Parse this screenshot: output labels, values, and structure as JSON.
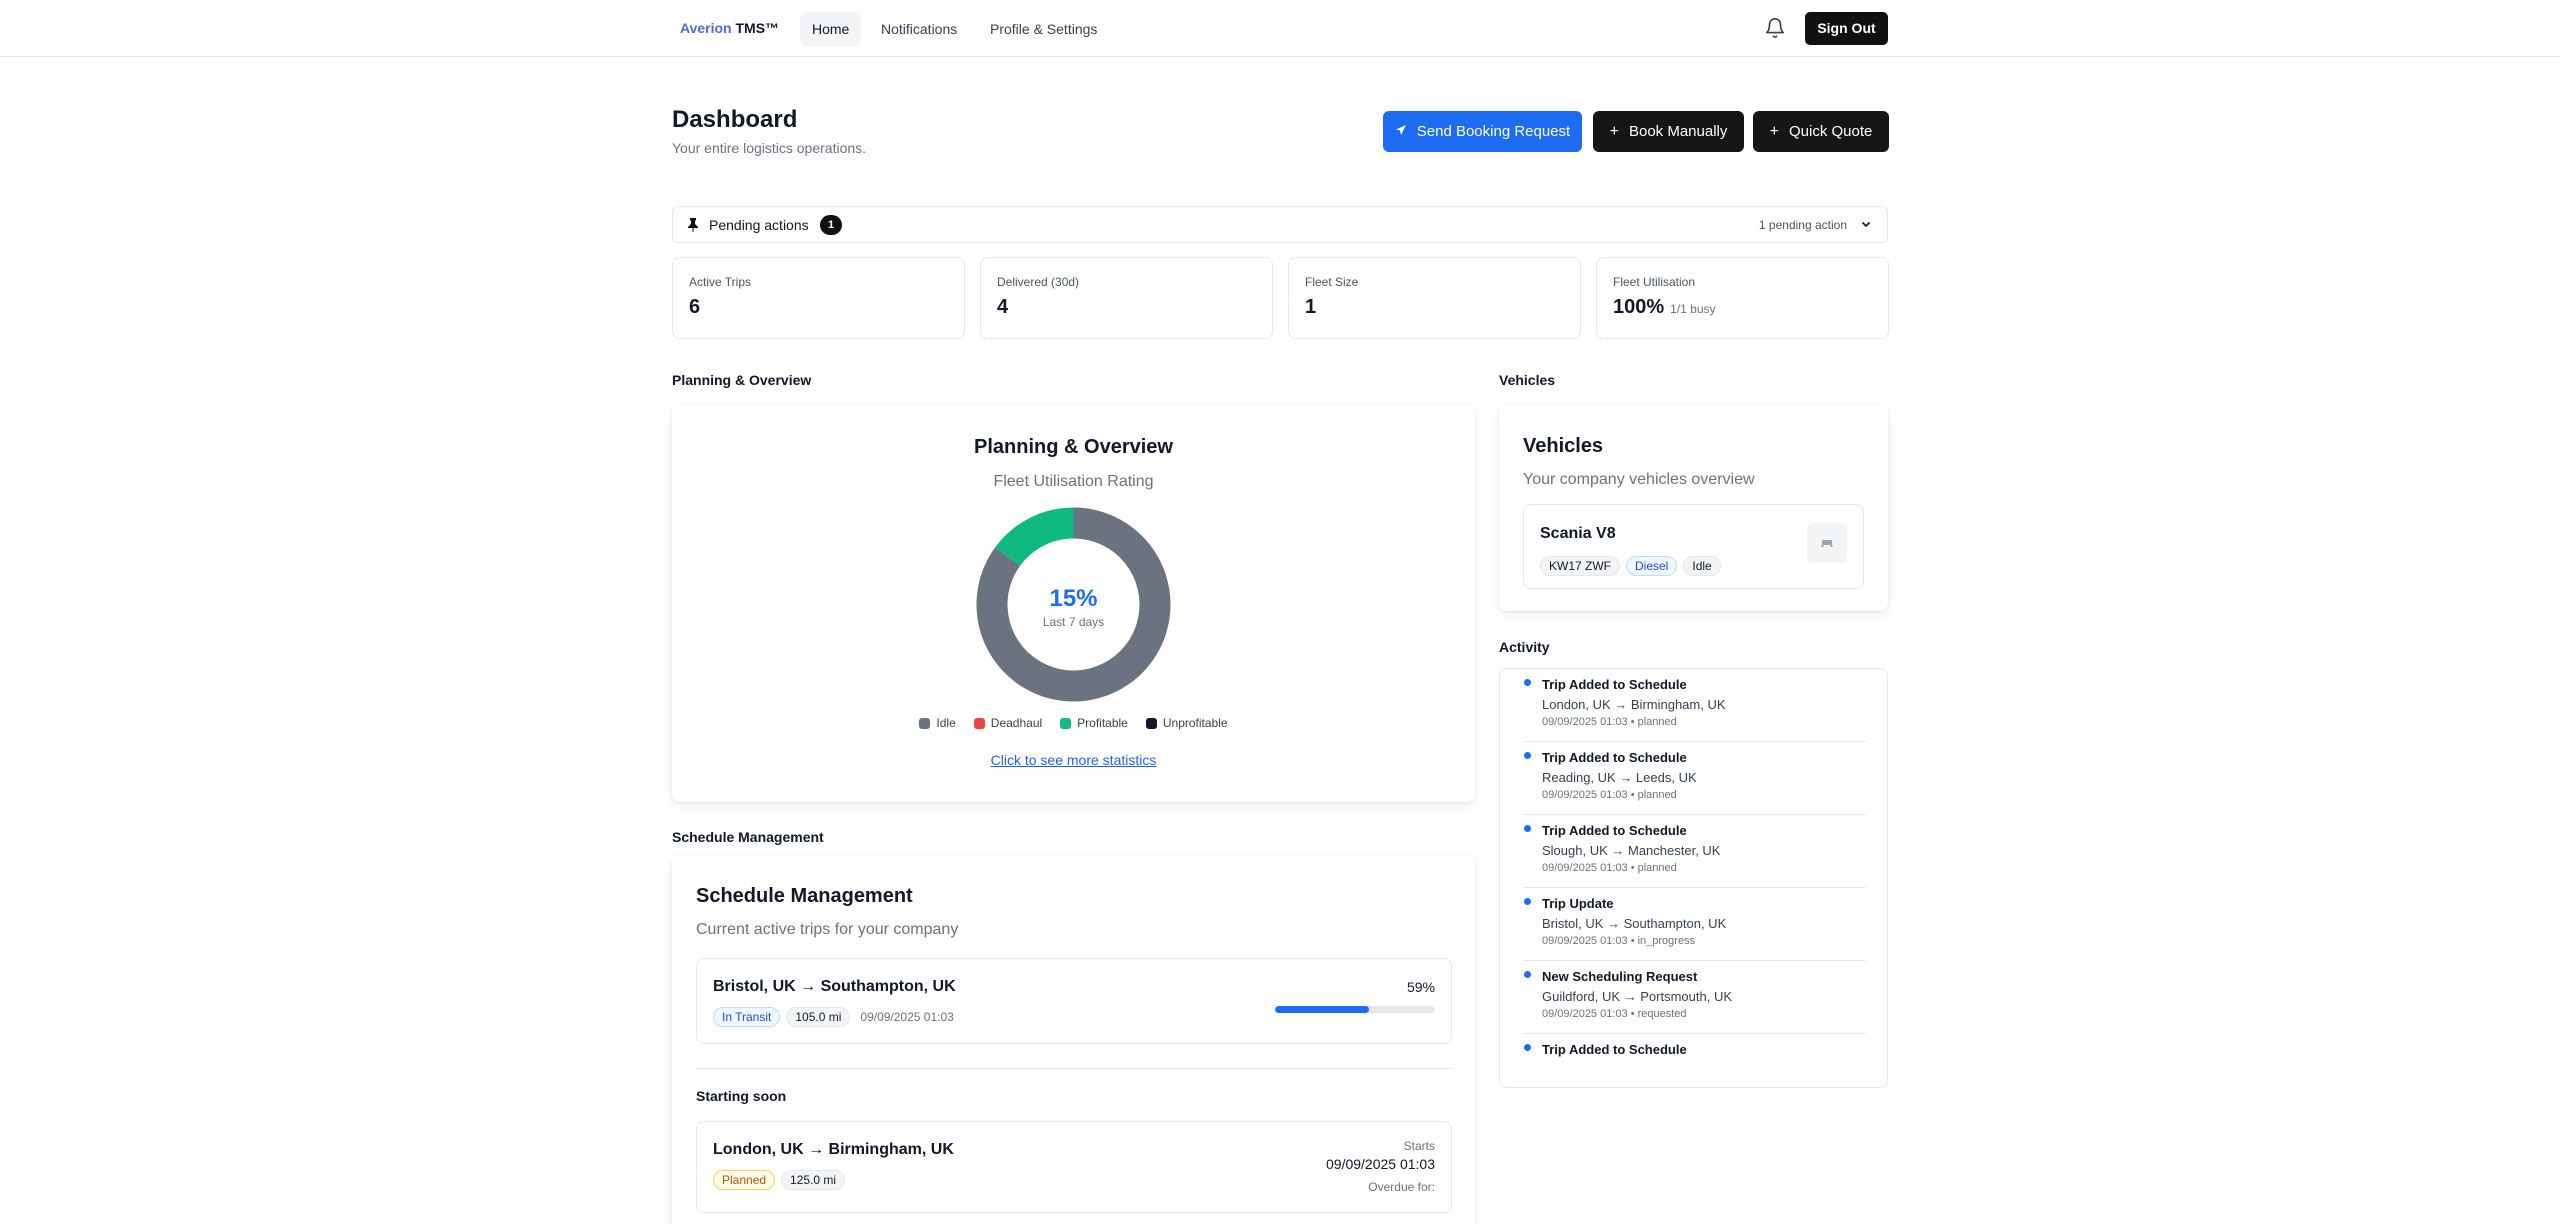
{
  "nav": {
    "brand_part1": "Averion",
    "brand_part2": "TMS™",
    "links": [
      "Home",
      "Notifications",
      "Profile & Settings"
    ],
    "sign_out": "Sign Out"
  },
  "header": {
    "title": "Dashboard",
    "subtitle": "Your entire logistics operations.",
    "buttons": {
      "send_booking": "Send Booking Request",
      "book_manually": "Book Manually",
      "quick_quote": "Quick Quote"
    }
  },
  "pending": {
    "label": "Pending actions",
    "count": "1",
    "summary": "1 pending action"
  },
  "stats": [
    {
      "label": "Active Trips",
      "value": "6",
      "sub": ""
    },
    {
      "label": "Delivered (30d)",
      "value": "4",
      "sub": ""
    },
    {
      "label": "Fleet Size",
      "value": "1",
      "sub": ""
    },
    {
      "label": "Fleet Utilisation",
      "value": "100%",
      "sub": "1/1 busy"
    }
  ],
  "sections": {
    "planning": "Planning & Overview",
    "vehicles": "Vehicles",
    "activity": "Activity",
    "schedule": "Schedule Management"
  },
  "planning": {
    "title": "Planning & Overview",
    "subtitle": "Fleet Utilisation Rating",
    "percent": "15%",
    "caption": "Last 7 days",
    "legend": [
      "Idle",
      "Deadhaul",
      "Profitable",
      "Unprofitable"
    ],
    "link": "Click to see more statistics"
  },
  "chart_data": {
    "type": "pie",
    "categories": [
      "Idle",
      "Deadhaul",
      "Profitable",
      "Unprofitable"
    ],
    "values": [
      85,
      0,
      15,
      0
    ],
    "colors": [
      "#6b7280",
      "#ef4444",
      "#10b981",
      "#111827"
    ],
    "center_label": "15%",
    "center_caption": "Last 7 days"
  },
  "colors": {
    "accent": "#1d6cf2",
    "dark_button": "#161616",
    "idle": "#6b7280",
    "deadhaul": "#ef4444",
    "profitable": "#10b981",
    "unprofitable": "#111827"
  },
  "vehicles": {
    "title": "Vehicles",
    "subtitle": "Your company vehicles overview",
    "items": [
      {
        "name": "Scania V8",
        "plate": "KW17 ZWF",
        "fuel": "Diesel",
        "status": "Idle",
        "icon": "truck-icon"
      }
    ]
  },
  "activity": [
    {
      "title": "Trip Added to Schedule",
      "route": "London, UK → Birmingham, UK",
      "meta": "09/09/2025 01:03 • planned"
    },
    {
      "title": "Trip Added to Schedule",
      "route": "Reading, UK → Leeds, UK",
      "meta": "09/09/2025 01:03 • planned"
    },
    {
      "title": "Trip Added to Schedule",
      "route": "Slough, UK → Manchester, UK",
      "meta": "09/09/2025 01:03 • planned"
    },
    {
      "title": "Trip Update",
      "route": "Bristol, UK → Southampton, UK",
      "meta": "09/09/2025 01:03 • in_progress"
    },
    {
      "title": "New Scheduling Request",
      "route": "Guildford, UK → Portsmouth, UK",
      "meta": "09/09/2025 01:03 • requested"
    },
    {
      "title": "Trip Added to Schedule",
      "route": "",
      "meta": ""
    }
  ],
  "schedule": {
    "title": "Schedule Management",
    "subtitle": "Current active trips for your company",
    "active": {
      "route": "Bristol, UK → Southampton, UK",
      "status": "In Transit",
      "distance": "105.0 mi",
      "date": "09/09/2025 01:03",
      "progress_label": "59%",
      "progress": 0.59
    },
    "starting_soon_label": "Starting soon",
    "soon": {
      "route": "London, UK → Birmingham, UK",
      "status": "Planned",
      "distance": "125.0 mi",
      "starts_label": "Starts",
      "starts_value": "09/09/2025 01:03",
      "overdue_label": "Overdue for:"
    }
  }
}
